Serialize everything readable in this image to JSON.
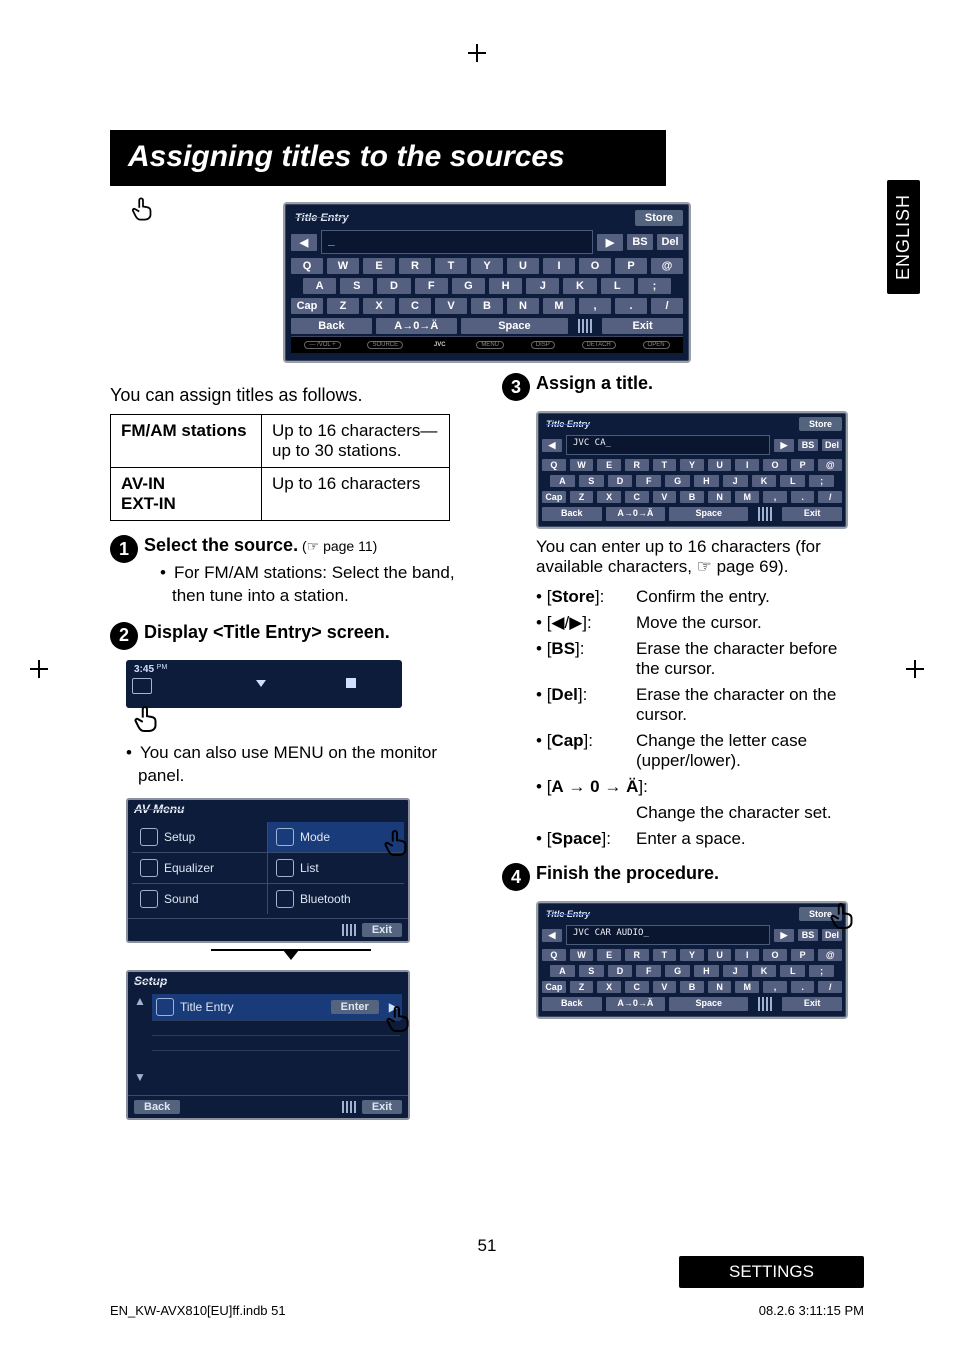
{
  "sidetab": "ENGLISH",
  "heading": "Assigning titles to the sources",
  "lead": "You can assign titles as follows.",
  "table": {
    "rows": [
      {
        "label": "FM/AM stations",
        "desc": "Up to 16 characters—up to 30 stations."
      },
      {
        "label": "AV-IN\nEXT-IN",
        "desc": "Up to 16 characters"
      }
    ]
  },
  "steps": {
    "s1": {
      "num": "1",
      "title_pre": "Select the source.",
      "ref": " (☞ page 11)",
      "bullet": "For FM/AM stations: Select the band, then tune into a station."
    },
    "s2": {
      "num": "2",
      "title": "Display <Title Entry> screen.",
      "also": "You can also use MENU on the monitor panel."
    },
    "s3": {
      "num": "3",
      "title": "Assign a title.",
      "lead": "You can enter up to 16 characters (for available characters, ☞ page 69)."
    },
    "s4": {
      "num": "4",
      "title": "Finish the procedure."
    }
  },
  "miniscreen": {
    "time": "3:45",
    "pm": "PM"
  },
  "avmenu": {
    "title": "AV Menu",
    "items": [
      "Setup",
      "Mode",
      "Equalizer",
      "List",
      "Sound",
      "Bluetooth"
    ],
    "exit": "Exit"
  },
  "setupmenu": {
    "title": "Setup",
    "row": "Title Entry",
    "enter": "Enter",
    "back": "Back",
    "exit": "Exit"
  },
  "osk": {
    "title": "Title Entry",
    "store": "Store",
    "text_blank": "_",
    "text_partial": "JVC CA_",
    "text_full": "JVC CAR AUDIO_",
    "bs": "BS",
    "del": "Del",
    "row1": [
      "Q",
      "W",
      "E",
      "R",
      "T",
      "Y",
      "U",
      "I",
      "O",
      "P",
      "@"
    ],
    "row2": [
      "A",
      "S",
      "D",
      "F",
      "G",
      "H",
      "J",
      "K",
      "L",
      ";"
    ],
    "row3": [
      "Cap",
      "Z",
      "X",
      "C",
      "V",
      "B",
      "N",
      "M",
      ",",
      ".",
      "/"
    ],
    "foot": {
      "back": "Back",
      "charset": "A→0→Ä",
      "space": "Space",
      "exit": "Exit"
    },
    "device": [
      "—  /VOL  +",
      "SOURCE",
      "JVC",
      "MENU",
      "DISP",
      "DETACH",
      "OPEN"
    ]
  },
  "keylist": [
    {
      "k": "[Store]:",
      "v": "Confirm the entry."
    },
    {
      "k": "[◀/▶]:",
      "v": "Move the cursor."
    },
    {
      "k": "[BS]:",
      "v": "Erase the character before the cursor."
    },
    {
      "k": "[Del]:",
      "v": "Erase the character on the cursor."
    },
    {
      "k": "[Cap]:",
      "v": "Change the letter case (upper/lower)."
    },
    {
      "k": "[A → 0 → Ä]:",
      "v": "Change the character set."
    },
    {
      "k": "[Space]:",
      "v": "Enter a space."
    }
  ],
  "footer": {
    "page": "51",
    "tag": "SETTINGS"
  },
  "printinfo": {
    "left": "EN_KW-AVX810[EU]ff.indb   51",
    "right": "08.2.6   3:11:15 PM"
  }
}
